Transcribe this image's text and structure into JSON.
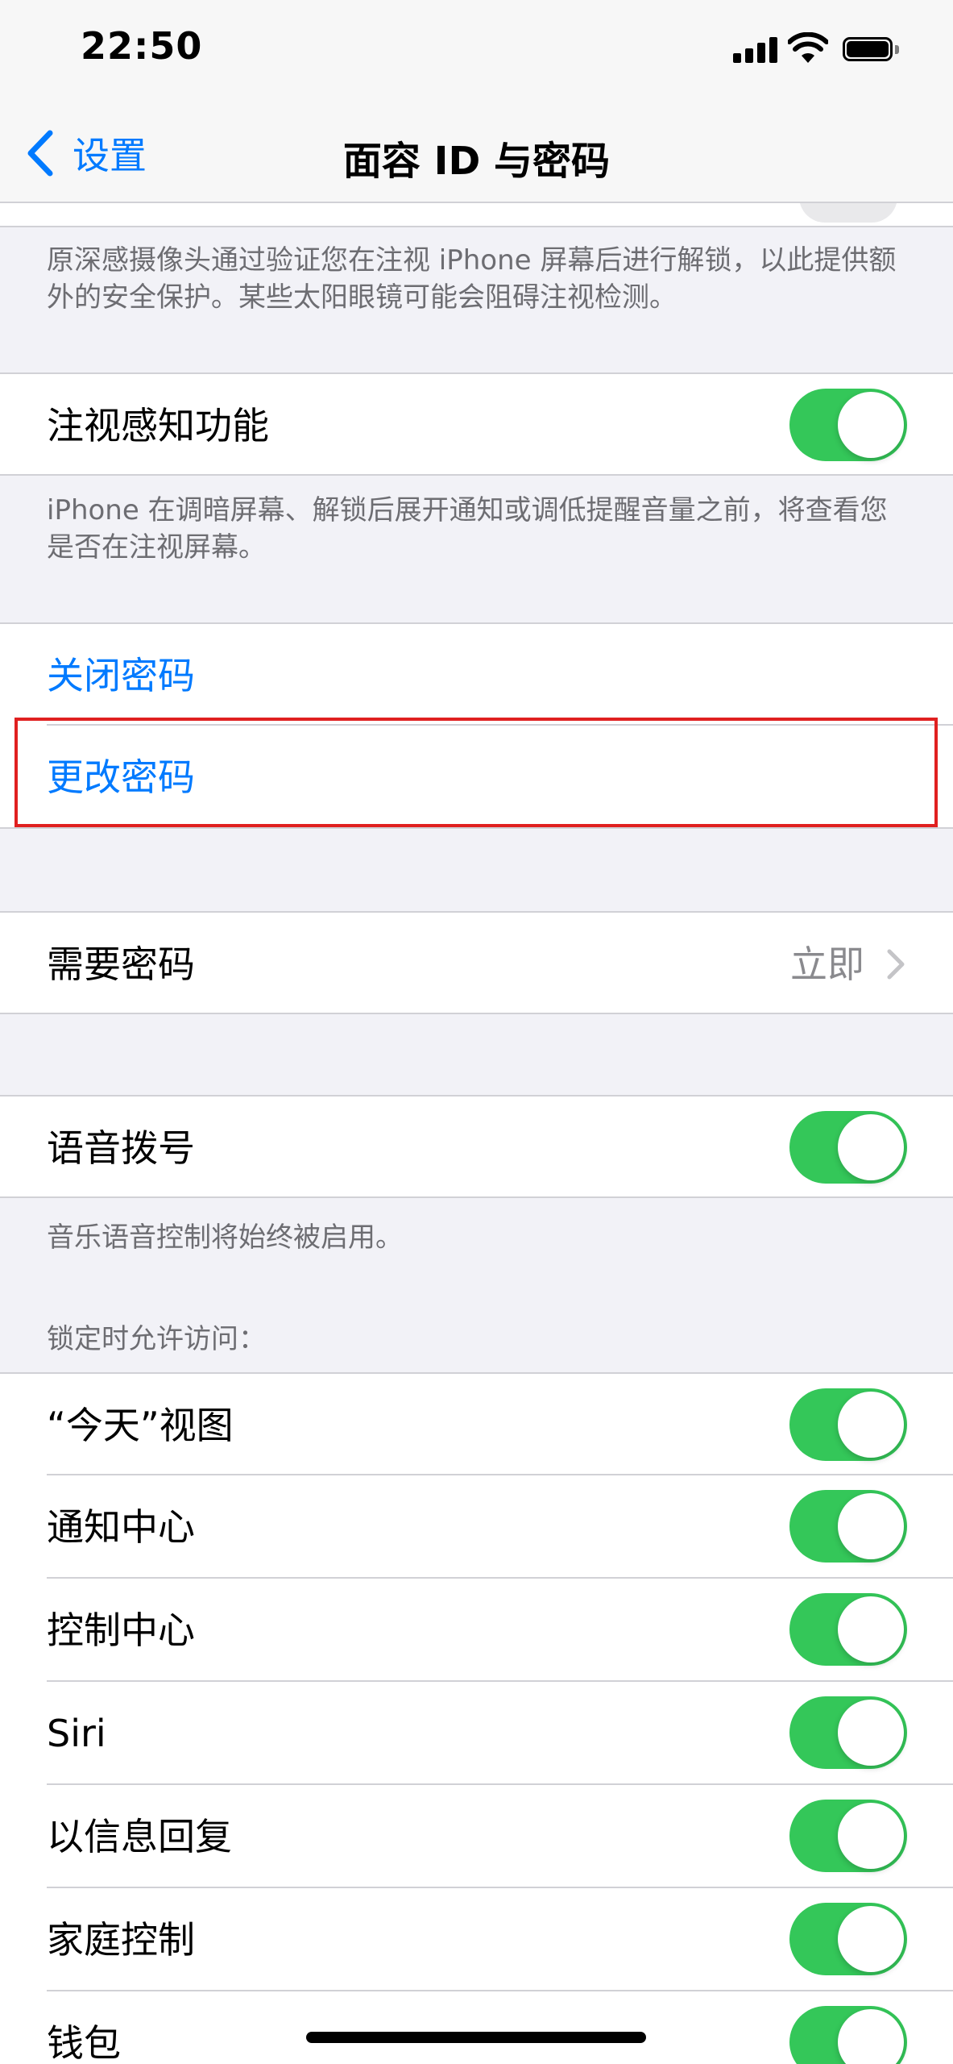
{
  "status_bar": {
    "time": "22:50"
  },
  "nav": {
    "back_label": "设置",
    "title": "面容 ID 与密码"
  },
  "attention_footer": "原深感摄像头通过验证您在注视 iPhone 屏幕后进行解锁，以此提供额外的安全保护。某些太阳眼镜可能会阻碍注视检测。",
  "attention_aware": {
    "label": "注视感知功能",
    "on": true
  },
  "attention_aware_footer": "iPhone 在调暗屏幕、解锁后展开通知或调低提醒音量之前，将查看您是否在注视屏幕。",
  "passcode": {
    "turn_off": "关闭密码",
    "change": "更改密码"
  },
  "require_passcode": {
    "label": "需要密码",
    "value": "立即"
  },
  "voice_dial": {
    "label": "语音拨号",
    "on": true
  },
  "voice_dial_footer": "音乐语音控制将始终被启用。",
  "lock_access_header": "锁定时允许访问：",
  "lock_access_items": [
    {
      "label": "“今天”视图",
      "on": true
    },
    {
      "label": "通知中心",
      "on": true
    },
    {
      "label": "控制中心",
      "on": true
    },
    {
      "label": "Siri",
      "on": true
    },
    {
      "label": "以信息回复",
      "on": true
    },
    {
      "label": "家庭控制",
      "on": true
    },
    {
      "label": "钱包",
      "on": true
    }
  ],
  "colors": {
    "accent": "#007aff",
    "toggle_on": "#34c759",
    "highlight": "#e02020",
    "background": "#f2f2f7"
  }
}
